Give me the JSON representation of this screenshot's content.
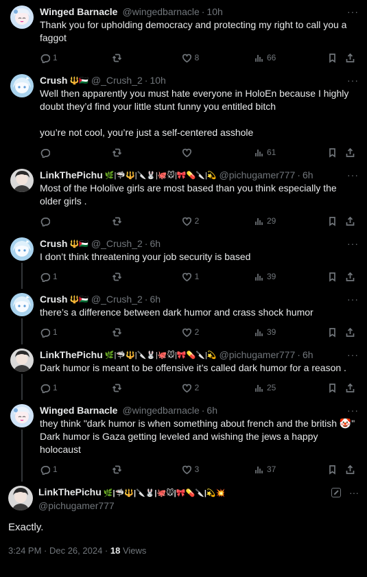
{
  "replies": [
    {
      "avatar": "winged",
      "name": "Winged Barnacle",
      "emojis": "",
      "handle": "@wingedbarnacle",
      "time": "10h",
      "text": "Thank you for upholding democracy and protecting my right to call you a faggot",
      "replies": "1",
      "retweets": "",
      "likes": "8",
      "views": "66",
      "connector": false
    },
    {
      "avatar": "crush",
      "name": "Crush",
      "emojis": "🔱🇵🇸",
      "handle": "@_Crush_2",
      "time": "10h",
      "text": "Well then apparently you must hate everyone in HoloEn because I highly doubt they’d find your little stunt funny you entitled bitch\n\nyou’re not cool, you’re just a self-centered asshole",
      "replies": "",
      "retweets": "",
      "likes": "",
      "views": "61",
      "connector": false
    },
    {
      "avatar": "link",
      "name": "LinkThePichu",
      "emojis": "🌿|🦈🔱|🔪🐰|🐙🐭|🎀💊🔪|💫",
      "handle": "@pichugamer777",
      "time": "6h",
      "text": "Most of the Hololive girls are most based than you think especially the older girls .",
      "replies": "",
      "retweets": "",
      "likes": "2",
      "views": "29",
      "connector": false
    },
    {
      "avatar": "crush",
      "name": "Crush",
      "emojis": "🔱🇵🇸",
      "handle": "@_Crush_2",
      "time": "6h",
      "text": "I don’t think threatening your job security is based",
      "replies": "1",
      "retweets": "",
      "likes": "1",
      "views": "39",
      "connector": true
    },
    {
      "avatar": "crush",
      "name": "Crush",
      "emojis": "🔱🇵🇸",
      "handle": "@_Crush_2",
      "time": "6h",
      "text": "there’s a difference between dark humor and crass shock humor",
      "replies": "1",
      "retweets": "",
      "likes": "2",
      "views": "39",
      "connector": true
    },
    {
      "avatar": "link",
      "name": "LinkThePichu",
      "emojis": "🌿|🦈🔱|🔪🐰|🐙🐭|🎀💊🔪|💫",
      "handle": "@pichugamer777",
      "time": "6h",
      "text": "Dark humor is meant to be offensive it’s called dark humor for a reason .",
      "replies": "1",
      "retweets": "",
      "likes": "2",
      "views": "25",
      "connector": true
    },
    {
      "avatar": "winged",
      "name": "Winged Barnacle",
      "emojis": "",
      "handle": "@wingedbarnacle",
      "time": "6h",
      "text": "they think \"dark humor is when something about french and the british 🤡\"\nDark humor is Gaza getting leveled and wishing the jews a happy holocaust",
      "replies": "1",
      "retweets": "",
      "likes": "3",
      "views": "37",
      "connector": true
    }
  ],
  "main": {
    "name": "LinkThePichu",
    "emojis": "🌿|🦈🔱|🔪🐰|🐙🐭|🎀💊🔪|💫💥",
    "handle": "@pichugamer777",
    "text": "Exactly.",
    "timestamp": "3:24 PM · Dec 26, 2024 · ",
    "views_count": "18",
    "views_label": " Views"
  },
  "colors": {
    "bg": "#000000",
    "text": "#e7e9ea",
    "muted": "#71767b",
    "line": "#333639"
  }
}
